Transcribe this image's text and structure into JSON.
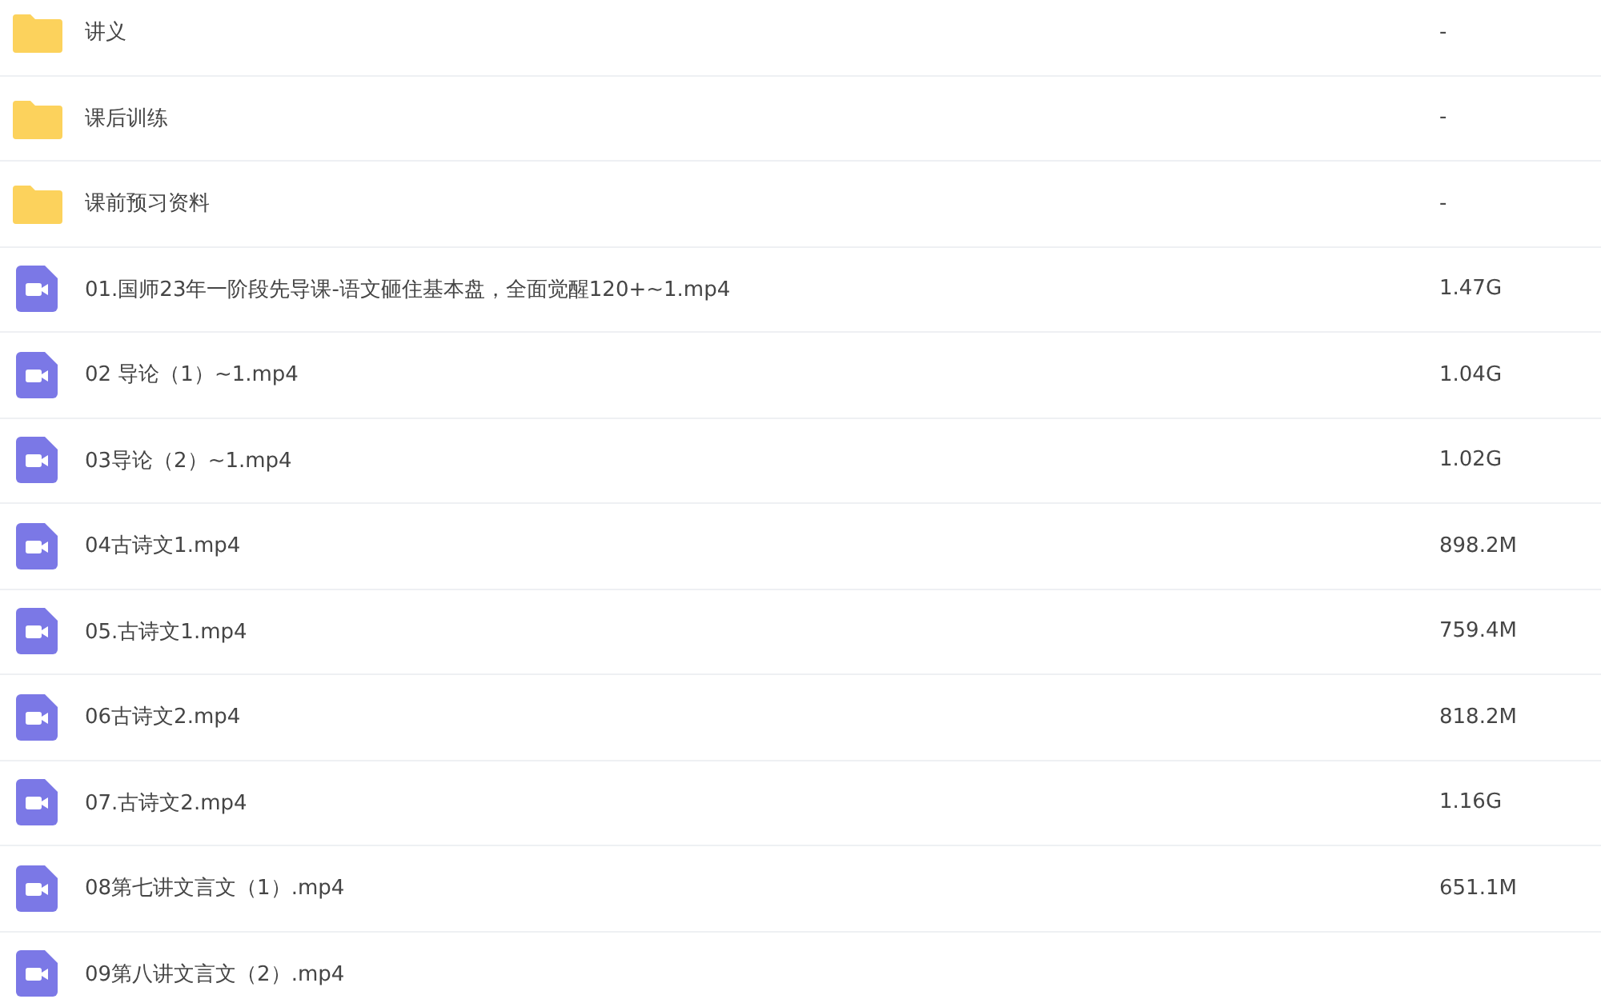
{
  "files": [
    {
      "kind": "folder",
      "name": "讲义",
      "size": "-"
    },
    {
      "kind": "folder",
      "name": "课后训练",
      "size": "-"
    },
    {
      "kind": "folder",
      "name": "课前预习资料",
      "size": "-"
    },
    {
      "kind": "video",
      "name": "01.国师23年一阶段先导课-语文砸住基本盘，全面觉醒120+~1.mp4",
      "size": "1.47G"
    },
    {
      "kind": "video",
      "name": "02 导论（1）~1.mp4",
      "size": "1.04G"
    },
    {
      "kind": "video",
      "name": "03导论（2）~1.mp4",
      "size": "1.02G"
    },
    {
      "kind": "video",
      "name": "04古诗文1.mp4",
      "size": "898.2M"
    },
    {
      "kind": "video",
      "name": "05.古诗文1.mp4",
      "size": "759.4M"
    },
    {
      "kind": "video",
      "name": "06古诗文2.mp4",
      "size": "818.2M"
    },
    {
      "kind": "video",
      "name": "07.古诗文2.mp4",
      "size": "1.16G"
    },
    {
      "kind": "video",
      "name": "08第七讲文言文（1）.mp4",
      "size": "651.1M"
    },
    {
      "kind": "video",
      "name": "09第八讲文言文（2）.mp4"
    }
  ]
}
